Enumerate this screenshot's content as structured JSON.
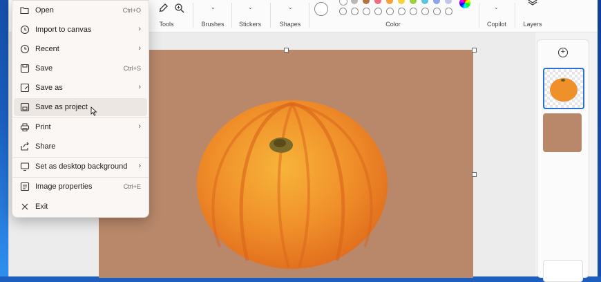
{
  "toolbar": {
    "groups": [
      {
        "label": "Tools"
      },
      {
        "label": "Brushes"
      },
      {
        "label": "Stickers"
      },
      {
        "label": "Shapes"
      },
      {
        "label": "Color"
      },
      {
        "label": "Copilot"
      },
      {
        "label": "Layers"
      }
    ],
    "palette_row_colors": [
      "#ffffff",
      "#b8b8b8",
      "#b5733f",
      "#f26b7f",
      "#f7a23b",
      "#f5d33b",
      "#9bd13a",
      "#5bc5d9",
      "#8fa3e8",
      "#c4c4e8"
    ]
  },
  "file_menu": {
    "items": [
      {
        "label": "Open",
        "shortcut": "Ctrl+O",
        "icon": "folder-open-icon"
      },
      {
        "label": "Import to canvas",
        "icon": "import-icon",
        "has_submenu": true
      },
      {
        "label": "Recent",
        "icon": "clock-icon",
        "has_submenu": true
      },
      {
        "label": "Save",
        "shortcut": "Ctrl+S",
        "icon": "save-icon"
      },
      {
        "label": "Save as",
        "icon": "save-as-icon",
        "has_submenu": true
      },
      {
        "label": "Save as project",
        "icon": "save-project-icon"
      },
      {
        "label": "Print",
        "icon": "printer-icon",
        "has_submenu": true
      },
      {
        "label": "Share",
        "icon": "share-icon"
      },
      {
        "label": "Set as desktop background",
        "icon": "desktop-background-icon",
        "has_submenu": true
      },
      {
        "label": "Image properties",
        "shortcut": "Ctrl+E",
        "icon": "image-properties-icon"
      },
      {
        "label": "Exit",
        "icon": "close-icon"
      }
    ],
    "hovered": "Save as project"
  },
  "canvas": {
    "background_color": "#b9886b",
    "image": "pumpkin"
  },
  "layers": {
    "count": 2
  }
}
